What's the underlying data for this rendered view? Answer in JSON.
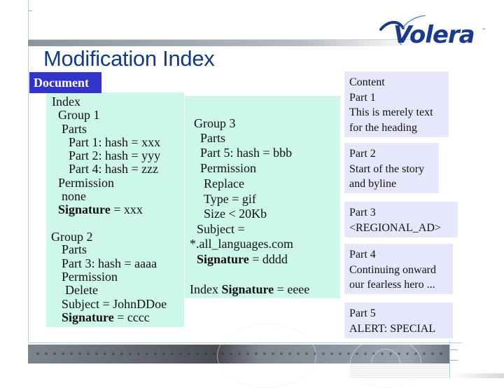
{
  "header": {
    "title": "Modification Index",
    "logo_text": "Volera",
    "logo_tm": "™"
  },
  "document_label": "Document",
  "index_panel": {
    "lines": [
      {
        "text": "Index"
      },
      {
        "text": "Group 1"
      },
      {
        "text": "Parts"
      },
      {
        "text": "Part 1: hash = xxx"
      },
      {
        "text": "Part 2: hash = yyy"
      },
      {
        "text": "Part 4: hash = zzz"
      },
      {
        "text": "Permission"
      },
      {
        "text": "none"
      },
      {
        "bold": "Signature",
        "text": " = xxx"
      },
      {
        "text": "Group 2"
      },
      {
        "text": "Parts"
      },
      {
        "text": "Part 3: hash = aaaa"
      },
      {
        "text": "Permission"
      },
      {
        "text": "Delete"
      },
      {
        "text": "Subject = JohnDDoe"
      },
      {
        "bold": "Signature",
        "text": " = cccc"
      }
    ]
  },
  "group3_panel": {
    "lines": [
      {
        "text": "Group 3"
      },
      {
        "text": "Parts"
      },
      {
        "text": "Part 5: hash = bbb"
      },
      {
        "text": "Permission"
      },
      {
        "text": "Replace"
      },
      {
        "text": "Type = gif"
      },
      {
        "text": "Size < 20Kb"
      },
      {
        "text": "Subject ="
      },
      {
        "text": "*.all_languages.com"
      },
      {
        "bold": "Signature",
        "text": " = dddd"
      },
      {
        "prefix": "Index ",
        "bold": "Signature",
        "text": " = eeee"
      }
    ]
  },
  "content_parts": [
    {
      "lines": [
        "Content",
        "Part 1",
        "This is merely text",
        "for the heading"
      ]
    },
    {
      "lines": [
        "Part 2",
        "Start of the story",
        "and byline"
      ]
    },
    {
      "lines": [
        "Part 3",
        "<REGIONAL_AD>"
      ]
    },
    {
      "lines": [
        "Part 4",
        "Continuing onward",
        "our fearless hero ..."
      ]
    },
    {
      "lines": [
        "Part 5",
        "ALERT: SPECIAL"
      ]
    }
  ],
  "colors": {
    "title": "#123a8a",
    "document_label_bg": "#3333cc",
    "index_bg": "#cdf7ea",
    "content_bg": "#e7e7fb",
    "logo": "#1a3a8c"
  }
}
